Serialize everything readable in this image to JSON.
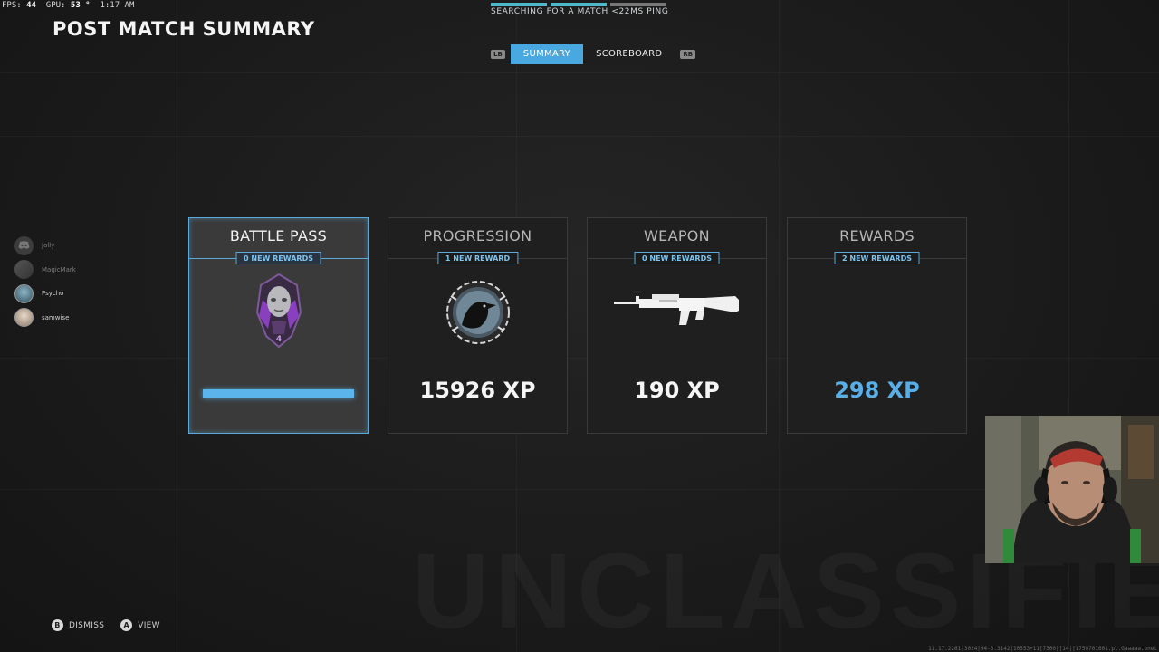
{
  "hud": {
    "fps_label": "FPS:",
    "fps_value": "44",
    "gpu_label": "GPU:",
    "gpu_value": "53 °",
    "time": "1:17 AM"
  },
  "page_title": "POST MATCH SUMMARY",
  "matchmaking": {
    "status_text": "SEARCHING FOR A MATCH <22MS PING"
  },
  "tabs": {
    "left_bumper": "LB",
    "right_bumper": "RB",
    "items": [
      {
        "label": "SUMMARY",
        "active": true
      },
      {
        "label": "SCOREBOARD",
        "active": false
      }
    ]
  },
  "cards": [
    {
      "title": "BATTLE PASS",
      "badge": "0 NEW REWARDS",
      "xp": "",
      "progress": 1.0,
      "icon": "battle-pass-tier-emblem"
    },
    {
      "title": "PROGRESSION",
      "badge": "1 NEW REWARD",
      "xp": "15926 XP",
      "icon": "raven-calling-card-emblem"
    },
    {
      "title": "WEAPON",
      "badge": "0 NEW REWARDS",
      "xp": "190 XP",
      "icon": "assault-rifle-icon"
    },
    {
      "title": "REWARDS",
      "badge": "2 NEW REWARDS",
      "xp": "298 XP",
      "icon": "none"
    }
  ],
  "party": [
    {
      "name": "Jolly",
      "active": false,
      "icon": "discord-icon"
    },
    {
      "name": "MagicMark",
      "active": false,
      "icon": "avatar"
    },
    {
      "name": "Psycho",
      "active": true,
      "icon": "avatar"
    },
    {
      "name": "samwise",
      "active": true,
      "icon": "avatar"
    }
  ],
  "prompts": {
    "dismiss_button": "B",
    "dismiss_label": "DISMISS",
    "view_button": "A",
    "view_label": "VIEW"
  },
  "watermark": "UNCLASSIFIED",
  "debug_string": "11.17.2261|3024|94-3.3142|10553+11|7300||14||1750701601.pl.Gaaaaa.bnet",
  "colors": {
    "accent_blue": "#4aa8e0",
    "progress_blue": "#5bb4ec",
    "search_teal": "#4fb8c6",
    "xp_blue": "#5aaee6"
  }
}
